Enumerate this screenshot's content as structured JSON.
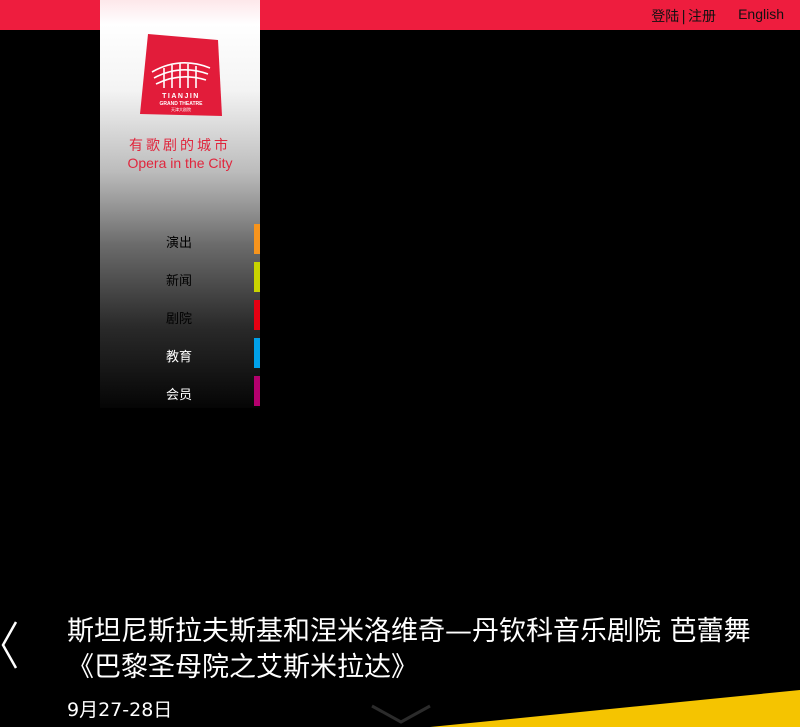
{
  "header": {
    "login": "登陆",
    "separator": "|",
    "register": "注册",
    "language": "English"
  },
  "brand": {
    "logo_text_line1": "TIANJIN",
    "logo_text_line2": "GRAND THEATRE",
    "logo_text_line3": "天津大剧院",
    "tagline_cn": "有歌剧的城市",
    "tagline_en": "Opera in the City",
    "color": "#e0263d"
  },
  "nav": {
    "items": [
      {
        "label": "演出",
        "color": "#f7941d"
      },
      {
        "label": "新闻",
        "color": "#c8d400"
      },
      {
        "label": "剧院",
        "color": "#e60012"
      },
      {
        "label": "教育",
        "color": "#00a0e9"
      },
      {
        "label": "会员",
        "color": "#b4006e"
      }
    ]
  },
  "slide": {
    "title_line1": "斯坦尼斯拉夫斯基和涅米洛维奇—丹钦科音乐剧院 芭蕾舞",
    "title_line2": "《巴黎圣母院之艾斯米拉达》",
    "date": "9月27-28日"
  },
  "colors": {
    "topbar": "#ee1d3e",
    "stripe": "#f5c400"
  }
}
